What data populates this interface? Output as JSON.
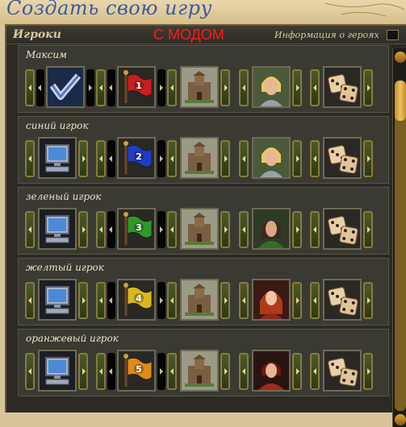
{
  "window": {
    "title": "Создать свою игру"
  },
  "annotation": {
    "text": "С МОДОМ",
    "color": "#ff1a1a"
  },
  "panel": {
    "players_label": "Игроки",
    "hero_info_label": "Информация о героях",
    "hero_info_checked": false
  },
  "players": [
    {
      "name": "Максим",
      "controller_icon": "human-checkmark-icon",
      "flag_number": "1",
      "flag_color": "#c81e1e",
      "hero_icon": "blonde-knight-portrait-icon",
      "town_icon": "castle-town-icon",
      "bonus_icon": "random-dice-icon"
    },
    {
      "name": "синий игрок",
      "controller_icon": "computer-monitor-icon",
      "flag_number": "2",
      "flag_color": "#1e3cc8",
      "hero_icon": "blonde-knight-portrait-icon",
      "town_icon": "castle-town-icon",
      "bonus_icon": "random-dice-icon"
    },
    {
      "name": "зеленый игрок",
      "controller_icon": "computer-monitor-icon",
      "flag_number": "3",
      "flag_color": "#2e9a2a",
      "hero_icon": "ranger-portrait-icon",
      "town_icon": "castle-town-icon",
      "bonus_icon": "random-dice-icon"
    },
    {
      "name": "желтый игрок",
      "controller_icon": "computer-monitor-icon",
      "flag_number": "4",
      "flag_color": "#d8b81e",
      "hero_icon": "red-haired-heroine-portrait-icon",
      "town_icon": "castle-town-icon",
      "bonus_icon": "random-dice-icon"
    },
    {
      "name": "оранжевый игрок",
      "controller_icon": "computer-monitor-icon",
      "flag_number": "5",
      "flag_color": "#e08a18",
      "hero_icon": "red-armored-heroine-portrait-icon",
      "town_icon": "castle-town-icon",
      "bonus_icon": "random-dice-icon"
    }
  ]
}
